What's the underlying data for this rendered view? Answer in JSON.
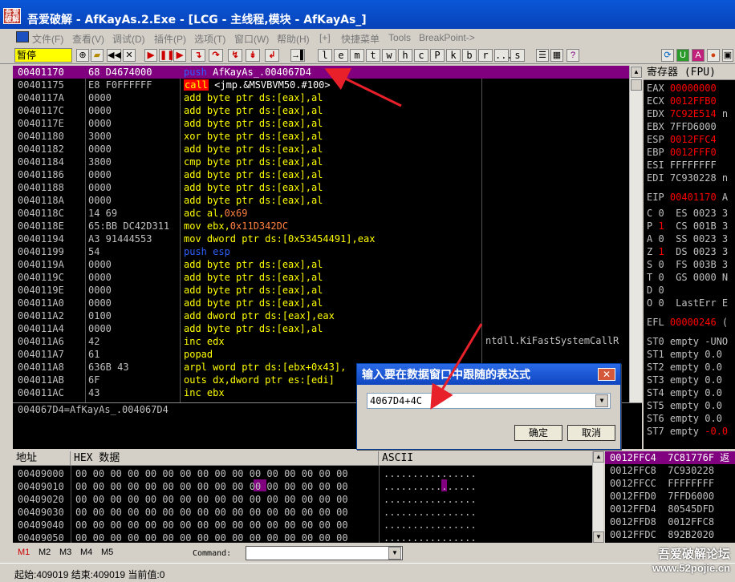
{
  "titlebar": {
    "logo": "吾爱破解",
    "title": "吾爱破解 - AfKayAs.2.Exe - [LCG - 主线程,模块 - AfKayAs_]"
  },
  "menu": [
    "文件(F)",
    "查看(V)",
    "调试(D)",
    "插件(P)",
    "选项(T)",
    "窗口(W)",
    "帮助(H)",
    "[+]",
    "快捷菜单",
    "Tools",
    "BreakPoint->"
  ],
  "toolbar": {
    "pause": "暂停",
    "letters": [
      "l",
      "e",
      "m",
      "t",
      "w",
      "h",
      "c",
      "P",
      "k",
      "b",
      "r",
      "...",
      "s"
    ]
  },
  "disasm": {
    "rows": [
      {
        "addr": "00401170",
        "hex": "68 D4674000",
        "ops": [
          {
            "t": "push ",
            "c": "op-b"
          },
          {
            "t": "AfKayAs_.004067D4",
            "c": "op-w"
          }
        ]
      },
      {
        "addr": "00401175",
        "hex": "E8 F0FFFFFF",
        "ops": [
          {
            "t": "call",
            "c": "callbox"
          },
          {
            "t": " <jmp.&MSVBVM50.#100>",
            "c": "op-w"
          }
        ]
      },
      {
        "addr": "0040117A",
        "hex": "0000",
        "ops": [
          {
            "t": "add byte ptr ds:[eax],al",
            "c": "op-y"
          }
        ]
      },
      {
        "addr": "0040117C",
        "hex": "0000",
        "ops": [
          {
            "t": "add byte ptr ds:[eax],al",
            "c": "op-y"
          }
        ]
      },
      {
        "addr": "0040117E",
        "hex": "0000",
        "ops": [
          {
            "t": "add byte ptr ds:[eax],al",
            "c": "op-y"
          }
        ]
      },
      {
        "addr": "00401180",
        "hex": "3000",
        "ops": [
          {
            "t": "xor byte ptr ds:[eax],al",
            "c": "op-y"
          }
        ]
      },
      {
        "addr": "00401182",
        "hex": "0000",
        "ops": [
          {
            "t": "add byte ptr ds:[eax],al",
            "c": "op-y"
          }
        ]
      },
      {
        "addr": "00401184",
        "hex": "3800",
        "ops": [
          {
            "t": "cmp byte ptr ds:[eax],al",
            "c": "op-y"
          }
        ]
      },
      {
        "addr": "00401186",
        "hex": "0000",
        "ops": [
          {
            "t": "add byte ptr ds:[eax],al",
            "c": "op-y"
          }
        ]
      },
      {
        "addr": "00401188",
        "hex": "0000",
        "ops": [
          {
            "t": "add byte ptr ds:[eax],al",
            "c": "op-y"
          }
        ]
      },
      {
        "addr": "0040118A",
        "hex": "0000",
        "ops": [
          {
            "t": "add byte ptr ds:[eax],al",
            "c": "op-y"
          }
        ]
      },
      {
        "addr": "0040118C",
        "hex": "14 69",
        "ops": [
          {
            "t": "adc al,",
            "c": "op-y"
          },
          {
            "t": "0x69",
            "c": "op-o"
          }
        ]
      },
      {
        "addr": "0040118E",
        "hex": "65:BB DC42D311",
        "ops": [
          {
            "t": "mov ebx,",
            "c": "op-y"
          },
          {
            "t": "0x11D342DC",
            "c": "op-o"
          }
        ]
      },
      {
        "addr": "00401194",
        "hex": "A3 91444553",
        "ops": [
          {
            "t": "mov dword ptr ds:[0x53454491],eax",
            "c": "op-y"
          }
        ]
      },
      {
        "addr": "00401199",
        "hex": "54",
        "ops": [
          {
            "t": "push esp",
            "c": "op-b"
          }
        ]
      },
      {
        "addr": "0040119A",
        "hex": "0000",
        "ops": [
          {
            "t": "add byte ptr ds:[eax],al",
            "c": "op-y"
          }
        ]
      },
      {
        "addr": "0040119C",
        "hex": "0000",
        "ops": [
          {
            "t": "add byte ptr ds:[eax],al",
            "c": "op-y"
          }
        ]
      },
      {
        "addr": "0040119E",
        "hex": "0000",
        "ops": [
          {
            "t": "add byte ptr ds:[eax],al",
            "c": "op-y"
          }
        ]
      },
      {
        "addr": "004011A0",
        "hex": "0000",
        "ops": [
          {
            "t": "add byte ptr ds:[eax],al",
            "c": "op-y"
          }
        ]
      },
      {
        "addr": "004011A2",
        "hex": "0100",
        "ops": [
          {
            "t": "add dword ptr ds:[eax],eax",
            "c": "op-y"
          }
        ]
      },
      {
        "addr": "004011A4",
        "hex": "0000",
        "ops": [
          {
            "t": "add byte ptr ds:[eax],al",
            "c": "op-y"
          }
        ]
      },
      {
        "addr": "004011A6",
        "hex": "42",
        "ops": [
          {
            "t": "inc edx",
            "c": "op-y"
          }
        ]
      },
      {
        "addr": "004011A7",
        "hex": "61",
        "ops": [
          {
            "t": "popad",
            "c": "op-y"
          }
        ]
      },
      {
        "addr": "004011A8",
        "hex": "636B 43",
        "ops": [
          {
            "t": "arpl word ptr ds:[ebx+0x43],",
            "c": "op-y"
          }
        ]
      },
      {
        "addr": "004011AB",
        "hex": "6F",
        "ops": [
          {
            "t": "outs dx,dword ptr es:[edi]",
            "c": "op-y"
          }
        ]
      },
      {
        "addr": "004011AC",
        "hex": "43",
        "ops": [
          {
            "t": "inc ebx",
            "c": "op-y"
          }
        ]
      }
    ],
    "comment": "ntdll.KiFastSystemCallR"
  },
  "info": "004067D4=AfKayAs_.004067D4",
  "registers": {
    "header": "寄存器 (FPU)",
    "rows": [
      {
        "n": "EAX",
        "v": "00000000",
        "c": "rv-red"
      },
      {
        "n": "ECX",
        "v": "0012FFB0",
        "c": "rv-red"
      },
      {
        "n": "EDX",
        "v": "7C92E514",
        "c": "rv-red",
        "s": " n"
      },
      {
        "n": "EBX",
        "v": "7FFD6000",
        "c": ""
      },
      {
        "n": "ESP",
        "v": "0012FFC4",
        "c": "rv-red"
      },
      {
        "n": "EBP",
        "v": "0012FFF0",
        "c": "rv-red"
      },
      {
        "n": "ESI",
        "v": "FFFFFFFF",
        "c": ""
      },
      {
        "n": "EDI",
        "v": "7C930228",
        "c": "",
        "s": " n"
      },
      {
        "n": "EIP",
        "v": "00401170",
        "c": "rv-red",
        "s": " A"
      }
    ],
    "flags": [
      {
        "f": "C 0",
        "seg": "ES 0023 3"
      },
      {
        "f": "P 1",
        "seg": "CS 001B 3"
      },
      {
        "f": "A 0",
        "seg": "SS 0023 3"
      },
      {
        "f": "Z 1",
        "seg": "DS 0023 3"
      },
      {
        "f": "S 0",
        "seg": "FS 003B 3"
      },
      {
        "f": "T 0",
        "seg": "GS 0000 N"
      },
      {
        "f": "D 0",
        "seg": ""
      },
      {
        "f": "O 0",
        "seg": "LastErr E"
      }
    ],
    "efl": "EFL 00000246 (",
    "fpu": [
      "ST0 empty -UNO",
      "ST1 empty 0.0",
      "ST2 empty 0.0",
      "ST3 empty 0.0",
      "ST4 empty 0.0",
      "ST5 empty 0.0",
      "ST6 empty 0.0",
      "ST7 empty -0.0"
    ]
  },
  "dump": {
    "headers": {
      "addr": "地址",
      "hex": "HEX 数据",
      "ascii": "ASCII"
    },
    "rows": [
      {
        "a": "00409000",
        "x": "00 00 00 00 00 00 00 00 00 00 00 00 00 00 00 00",
        "s": "................"
      },
      {
        "a": "00409010",
        "x": "00 00 00 00 00 00 00 00 00 00 00 00 00 00 00 00",
        "s": "................"
      },
      {
        "a": "00409020",
        "x": "00 00 00 00 00 00 00 00 00 00 00 00 00 00 00 00",
        "s": "................"
      },
      {
        "a": "00409030",
        "x": "00 00 00 00 00 00 00 00 00 00 00 00 00 00 00 00",
        "s": "................"
      },
      {
        "a": "00409040",
        "x": "00 00 00 00 00 00 00 00 00 00 00 00 00 00 00 00",
        "s": "................"
      },
      {
        "a": "00409050",
        "x": "00 00 00 00 00 00 00 00 00 00 00 00 00 00 00 00",
        "s": "................"
      }
    ]
  },
  "stack": {
    "rows": [
      {
        "a": "0012FFC4",
        "v": "7C81776F"
      },
      {
        "a": "0012FFC8",
        "v": "7C930228"
      },
      {
        "a": "0012FFCC",
        "v": "FFFFFFFF"
      },
      {
        "a": "0012FFD0",
        "v": "7FFD6000"
      },
      {
        "a": "0012FFD4",
        "v": "80545DFD"
      },
      {
        "a": "0012FFD8",
        "v": "0012FFC8"
      },
      {
        "a": "0012FFDC",
        "v": "892B2020"
      }
    ],
    "header_tail": "返"
  },
  "cmdbar": {
    "tabs": [
      "M1",
      "M2",
      "M3",
      "M4",
      "M5"
    ],
    "label": "Command:"
  },
  "status": "起始:409019 结束:409019 当前值:0",
  "watermark": {
    "line1": "吾爱破解论坛",
    "line2": "www.52pojie.cn"
  },
  "dialog": {
    "title": "输入要在数据窗口中跟随的表达式",
    "value": "4067D4+4C",
    "ok": "确定",
    "cancel": "取消"
  }
}
